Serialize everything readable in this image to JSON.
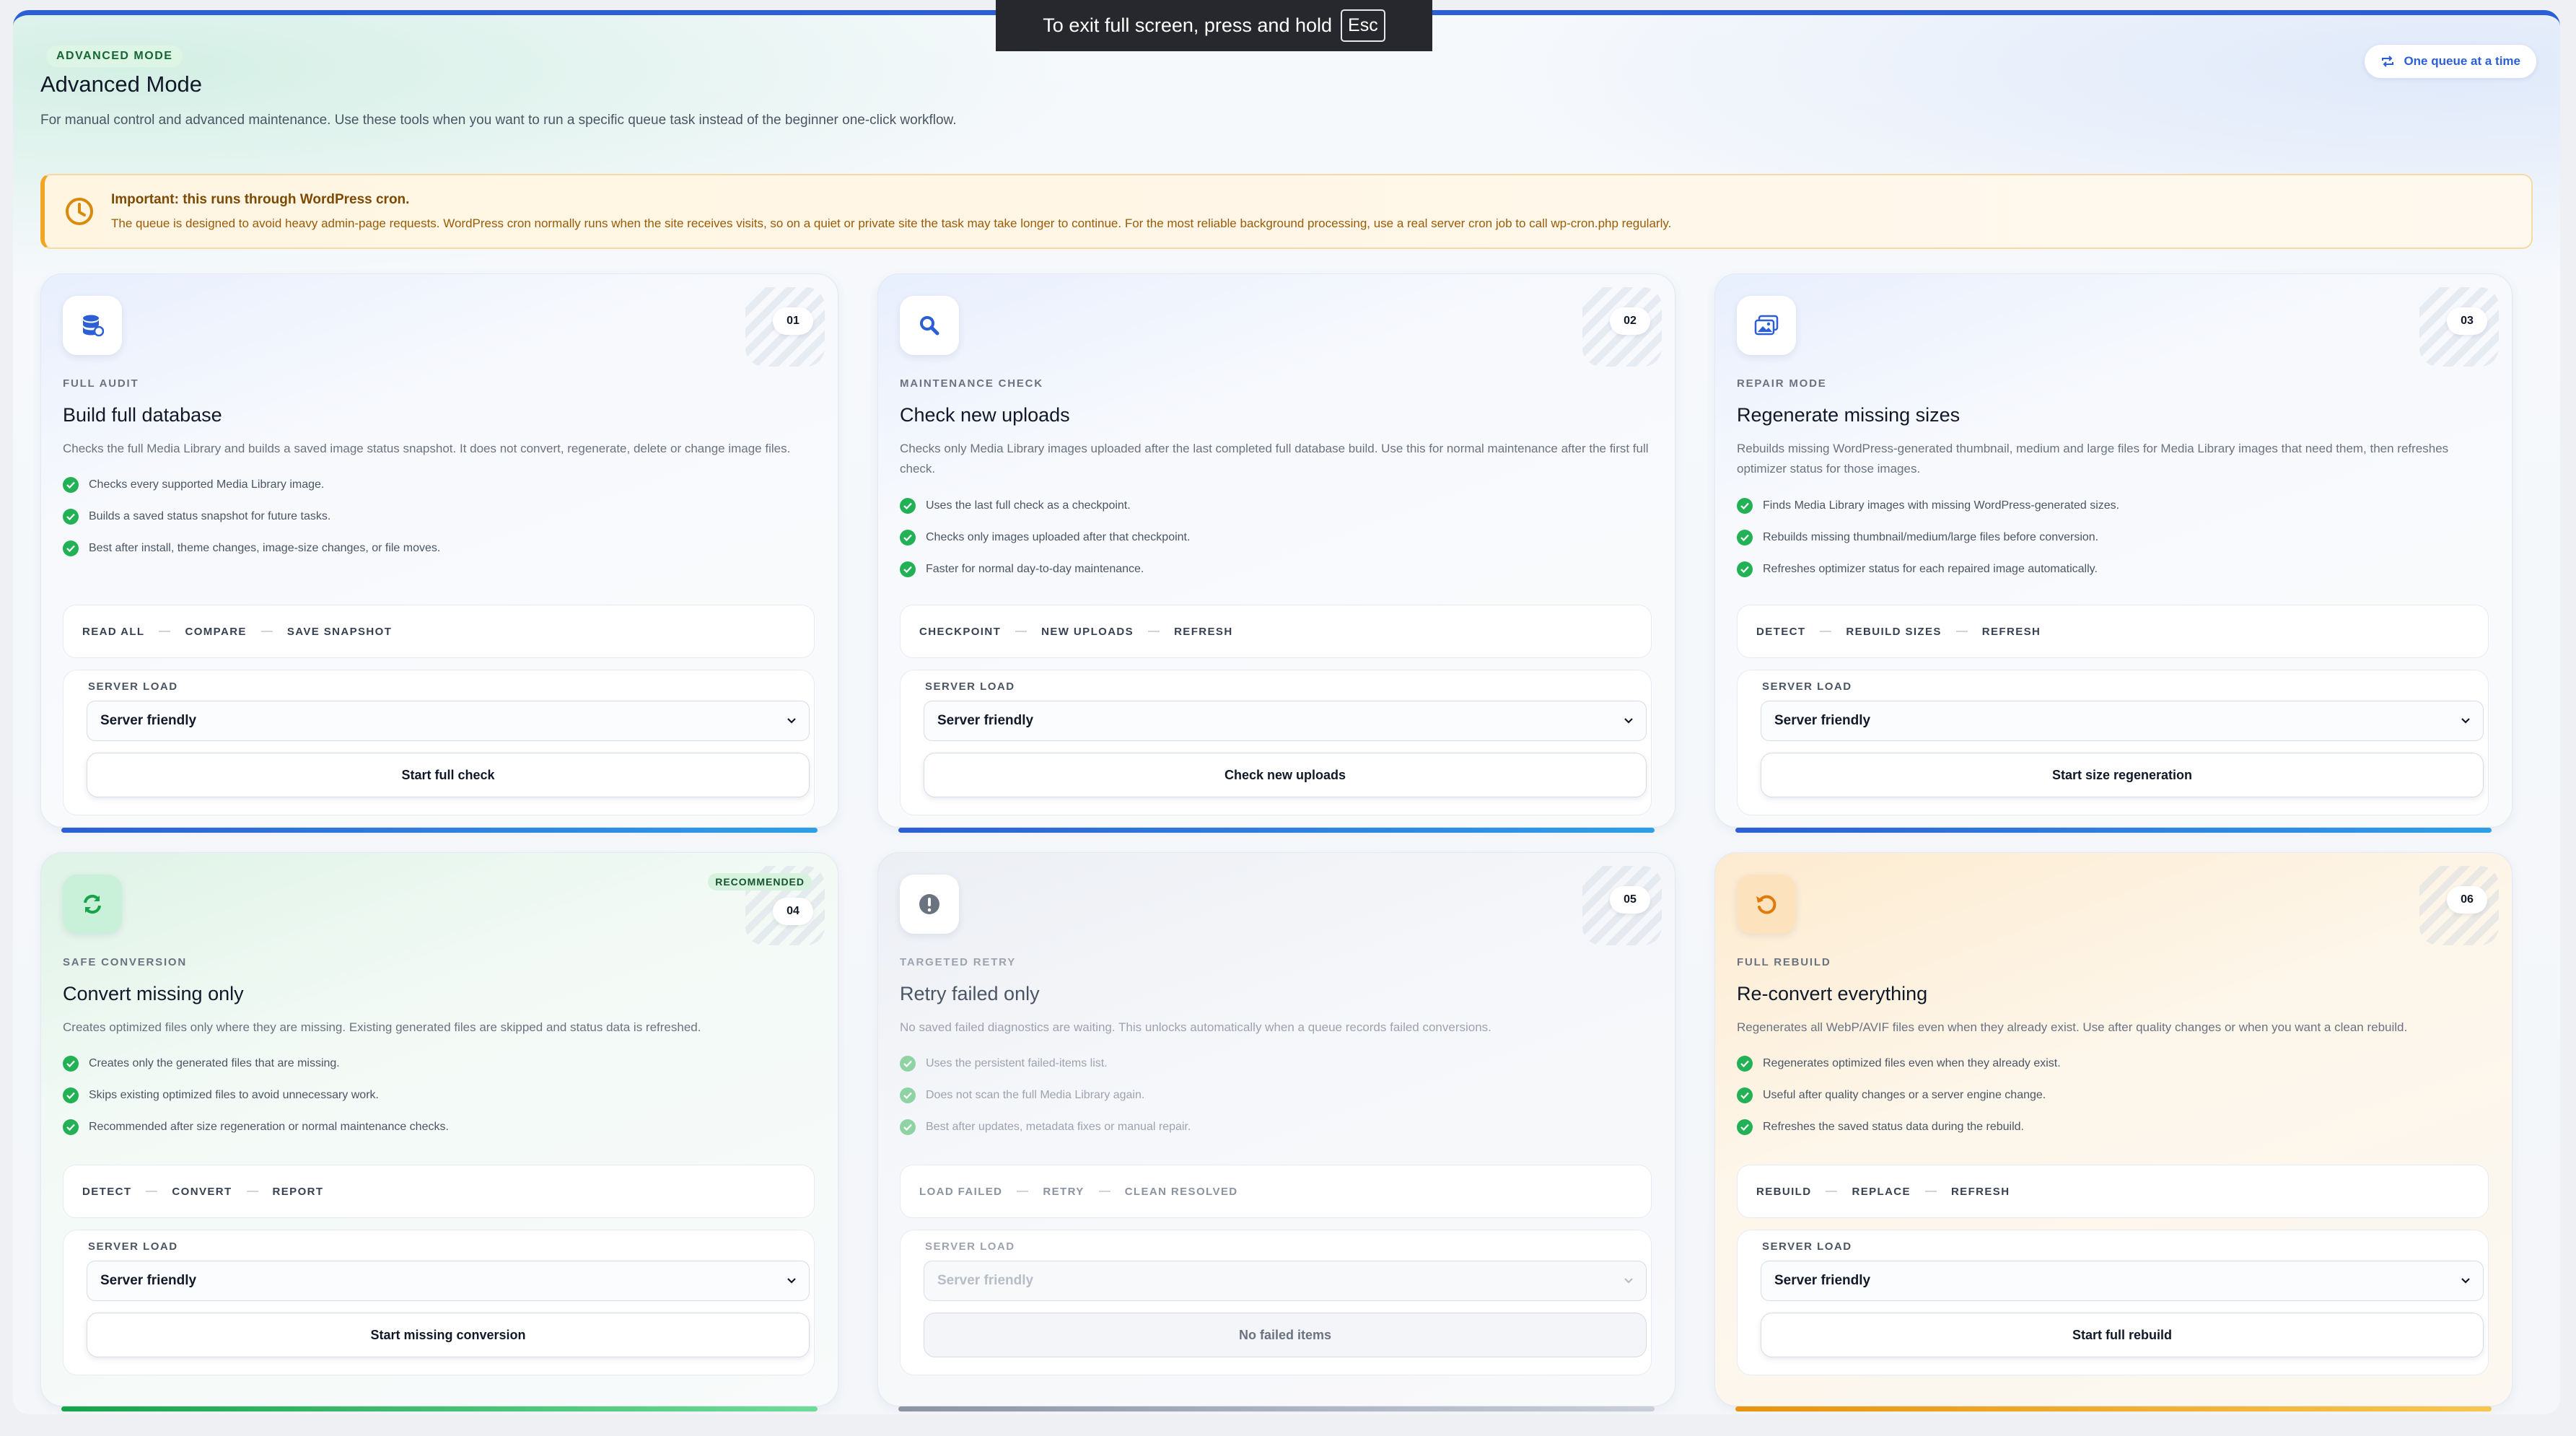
{
  "header": {
    "badge": "ADVANCED MODE",
    "title": "Advanced Mode",
    "description": "For manual control and advanced maintenance. Use these tools when you want to run a specific queue task instead of the beginner one-click workflow.",
    "queue_pill": "One queue at a time"
  },
  "notice": {
    "title": "Important: this runs through WordPress cron.",
    "body": "The queue is designed to avoid heavy admin-page requests. WordPress cron normally runs when the site receives visits, so on a quiet or private site the task may take longer to continue. For the most reliable background processing, use a real server cron job to call wp-cron.php regularly."
  },
  "fullscreen_toast": {
    "text": "To exit full screen, press and hold",
    "key": "Esc"
  },
  "server_load_label": "SERVER LOAD",
  "cards": [
    {
      "number": "01",
      "icon": "database-icon",
      "eyebrow": "FULL AUDIT",
      "title": "Build full database",
      "description": "Checks the full Media Library and builds a saved image status snapshot. It does not convert, regenerate, delete or change image files.",
      "bullets": [
        "Checks every supported Media Library image.",
        "Builds a saved status snapshot for future tasks.",
        "Best after install, theme changes, image-size changes, or file moves."
      ],
      "steps": [
        "READ ALL",
        "COMPARE",
        "SAVE SNAPSHOT"
      ],
      "server_load": "Server friendly",
      "action": "Start full check"
    },
    {
      "number": "02",
      "icon": "search-icon",
      "eyebrow": "MAINTENANCE CHECK",
      "title": "Check new uploads",
      "description": "Checks only Media Library images uploaded after the last completed full database build. Use this for normal maintenance after the first full check.",
      "bullets": [
        "Uses the last full check as a checkpoint.",
        "Checks only images uploaded after that checkpoint.",
        "Faster for normal day-to-day maintenance."
      ],
      "steps": [
        "CHECKPOINT",
        "NEW UPLOADS",
        "REFRESH"
      ],
      "server_load": "Server friendly",
      "action": "Check new uploads"
    },
    {
      "number": "03",
      "icon": "image-stack-icon",
      "eyebrow": "REPAIR MODE",
      "title": "Regenerate missing sizes",
      "description": "Rebuilds missing WordPress-generated thumbnail, medium and large files for Media Library images that need them, then refreshes optimizer status for those images.",
      "bullets": [
        "Finds Media Library images with missing WordPress-generated sizes.",
        "Rebuilds missing thumbnail/medium/large files before conversion.",
        "Refreshes optimizer status for each repaired image automatically."
      ],
      "steps": [
        "DETECT",
        "REBUILD SIZES",
        "REFRESH"
      ],
      "server_load": "Server friendly",
      "action": "Start size regeneration"
    },
    {
      "number": "04",
      "icon": "sync-icon",
      "badge": "RECOMMENDED",
      "eyebrow": "SAFE CONVERSION",
      "title": "Convert missing only",
      "description": "Creates optimized files only where they are missing. Existing generated files are skipped and status data is refreshed.",
      "bullets": [
        "Creates only the generated files that are missing.",
        "Skips existing optimized files to avoid unnecessary work.",
        "Recommended after size regeneration or normal maintenance checks."
      ],
      "steps": [
        "DETECT",
        "CONVERT",
        "REPORT"
      ],
      "server_load": "Server friendly",
      "action": "Start missing conversion"
    },
    {
      "number": "05",
      "icon": "alert-icon",
      "eyebrow": "TARGETED RETRY",
      "title": "Retry failed only",
      "description": "No saved failed diagnostics are waiting. This unlocks automatically when a queue records failed conversions.",
      "bullets": [
        "Uses the persistent failed-items list.",
        "Does not scan the full Media Library again.",
        "Best after updates, metadata fixes or manual repair."
      ],
      "steps": [
        "LOAD FAILED",
        "RETRY",
        "CLEAN RESOLVED"
      ],
      "server_load": "Server friendly",
      "action": "No failed items"
    },
    {
      "number": "06",
      "icon": "rotate-icon",
      "eyebrow": "FULL REBUILD",
      "title": "Re-convert everything",
      "description": "Regenerates all WebP/AVIF files even when they already exist. Use after quality changes or when you want a clean rebuild.",
      "bullets": [
        "Regenerates optimized files even when they already exist.",
        "Useful after quality changes or a server engine change.",
        "Refreshes the saved status data during the rebuild."
      ],
      "steps": [
        "REBUILD",
        "REPLACE",
        "REFRESH"
      ],
      "server_load": "Server friendly",
      "action": "Start full rebuild"
    }
  ]
}
